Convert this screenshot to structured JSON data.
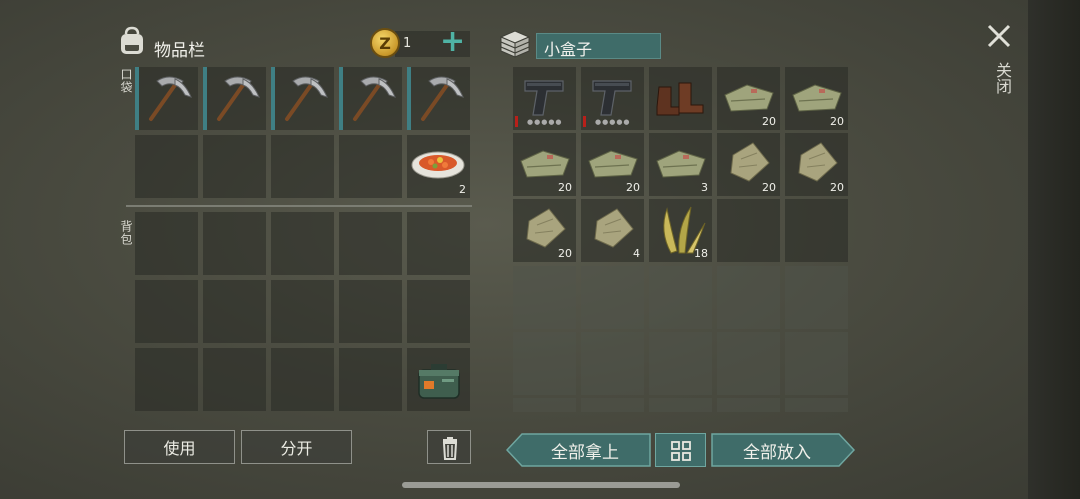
{
  "inventory": {
    "title": "物品栏",
    "coins": "1",
    "pocket_label": "口袋",
    "backpack_label": "背包",
    "pocket_slots": [
      {
        "item": "pickaxe-icon",
        "qty": ""
      },
      {
        "item": "pickaxe-icon",
        "qty": ""
      },
      {
        "item": "pickaxe-icon",
        "qty": ""
      },
      {
        "item": "pickaxe-icon",
        "qty": ""
      },
      {
        "item": "pickaxe-icon",
        "qty": ""
      },
      {
        "item": "",
        "qty": ""
      },
      {
        "item": "",
        "qty": ""
      },
      {
        "item": "",
        "qty": ""
      },
      {
        "item": "",
        "qty": ""
      },
      {
        "item": "food-plate-icon",
        "qty": "2"
      }
    ],
    "backpack_slots": [
      {
        "item": "",
        "qty": ""
      },
      {
        "item": "",
        "qty": ""
      },
      {
        "item": "",
        "qty": ""
      },
      {
        "item": "",
        "qty": ""
      },
      {
        "item": "",
        "qty": ""
      },
      {
        "item": "",
        "qty": ""
      },
      {
        "item": "",
        "qty": ""
      },
      {
        "item": "",
        "qty": ""
      },
      {
        "item": "",
        "qty": ""
      },
      {
        "item": "",
        "qty": ""
      },
      {
        "item": "",
        "qty": ""
      },
      {
        "item": "",
        "qty": ""
      },
      {
        "item": "",
        "qty": ""
      },
      {
        "item": "",
        "qty": ""
      },
      {
        "item": "supply-case-icon",
        "qty": ""
      }
    ],
    "use_label": "使用",
    "split_label": "分开"
  },
  "container": {
    "title": "小盒子",
    "slots": [
      {
        "item": "pistol-icon",
        "qty": ""
      },
      {
        "item": "pistol-icon",
        "qty": ""
      },
      {
        "item": "boots-icon",
        "qty": ""
      },
      {
        "item": "cloth-icon",
        "qty": "20"
      },
      {
        "item": "cloth-icon",
        "qty": "20"
      },
      {
        "item": "cloth-icon",
        "qty": "20"
      },
      {
        "item": "cloth-icon",
        "qty": "20"
      },
      {
        "item": "cloth-icon",
        "qty": "3"
      },
      {
        "item": "leather-icon",
        "qty": "20"
      },
      {
        "item": "leather-icon",
        "qty": "20"
      },
      {
        "item": "leather-icon",
        "qty": "20"
      },
      {
        "item": "leather-icon",
        "qty": "4"
      },
      {
        "item": "plant-fiber-icon",
        "qty": "18"
      }
    ],
    "take_all_label": "全部拿上",
    "put_all_label": "全部放入"
  },
  "close_label": "关闭",
  "colors": {
    "accent": "#4fb3a5",
    "teal_button": "#3f6c69",
    "durability_red": "#b8201a"
  }
}
